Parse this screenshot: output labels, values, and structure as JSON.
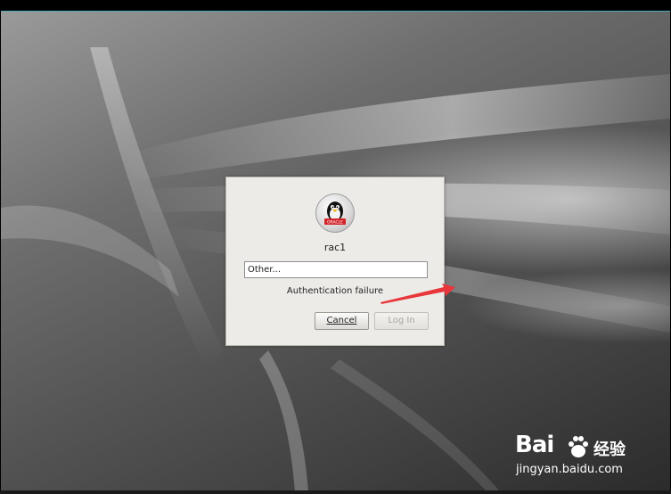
{
  "login_dialog": {
    "username": "rac1",
    "user_field_value": "Other...",
    "message": "Authentication failure",
    "cancel_label": "Cancel",
    "login_label": "Log In"
  },
  "avatar": {
    "badge_text": "ORACLE"
  },
  "watermark": {
    "logo_text": "Bai",
    "logo_suffix": "经验",
    "url": "jingyan.baidu.com"
  },
  "colors": {
    "annotation_arrow": "#e8363a",
    "dialog_background": "#ecebe8"
  }
}
